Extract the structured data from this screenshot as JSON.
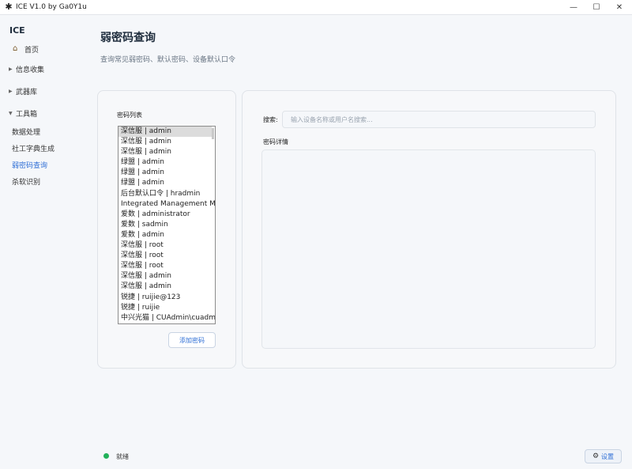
{
  "window": {
    "title": "ICE V1.0 by Ga0Y1u",
    "app_icon": "star-burst-icon",
    "controls": {
      "minimize": "—",
      "maximize": "☐",
      "close": "✕"
    }
  },
  "sidebar": {
    "brand": "ICE",
    "home": {
      "label": "首页",
      "icon": "home-icon"
    },
    "groups": [
      {
        "label": "信息收集",
        "expanded": false
      },
      {
        "label": "武器库",
        "expanded": false
      },
      {
        "label": "工具箱",
        "expanded": true
      }
    ],
    "sub_items": [
      {
        "label": "数据处理",
        "active": false
      },
      {
        "label": "社工字典生成",
        "active": false
      },
      {
        "label": "弱密码查询",
        "active": true
      },
      {
        "label": "杀软识别",
        "active": false
      }
    ]
  },
  "page": {
    "title": "弱密码查询",
    "subtitle": "查询常见弱密码、默认密码、设备默认口令"
  },
  "password_list": {
    "title": "密码列表",
    "items": [
      "深信服 | admin",
      "深信服 | admin",
      "深信服 | admin",
      "绿盟 | admin",
      "绿盟 | admin",
      "绿盟 | admin",
      "后台默认口令 | hradmin",
      "Integrated Management Mo",
      "爱数 | administrator",
      "爱数 | sadmin",
      "爱数 | admin",
      "深信服 | root",
      "深信服 | root",
      "深信服 | root",
      "深信服 | admin",
      "深信服 | admin",
      "锐捷 | ruijie@123",
      "锐捷 | ruijie",
      "中兴光猫 | CUAdmin\\cuadmi"
    ],
    "selected_index": 0,
    "add_button": "添加密码"
  },
  "search": {
    "label": "搜索:",
    "value": "",
    "placeholder": "输入设备名称或用户名搜索..."
  },
  "detail": {
    "label": "密码详情"
  },
  "status": {
    "text": "就绪",
    "color": "#22b15a"
  },
  "settings": {
    "label": "设置",
    "icon": "gear-icon"
  },
  "colors": {
    "accent": "#2f6fd6",
    "background": "#f5f7fa"
  }
}
